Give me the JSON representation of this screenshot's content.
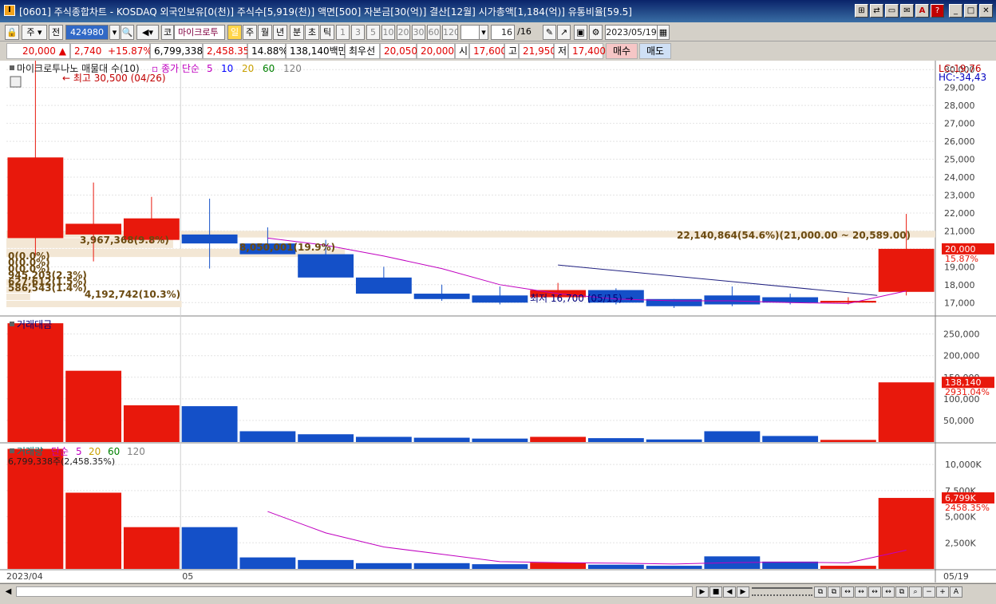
{
  "window": {
    "title": "[0601] 주식종합차트 - KOSDAQ 외국인보유[0(천)] 주식수[5,919(천)] 액면[500] 자본금[30(억)] 결산[12월] 시가총액[1,184(억)] 유통비율[59.5]",
    "app_icon": "I",
    "controls": [
      "⊞",
      "⇄",
      "▭",
      "✉",
      "A",
      "?",
      "_",
      "□",
      "✕"
    ]
  },
  "toolbar": {
    "mode": "주",
    "prefix": "전",
    "code": "424980",
    "stock_prefix": "코",
    "stock_name": "마이크로투",
    "periods": [
      "일",
      "주",
      "월",
      "년",
      "분",
      "초",
      "틱"
    ],
    "intervals": [
      "1",
      "3",
      "5",
      "10",
      "20",
      "30",
      "60",
      "120"
    ],
    "count": "16",
    "count_total": "/16",
    "date": "2023/05/19"
  },
  "quote": {
    "price": "20,000",
    "change": "2,740",
    "change_pct": "+15.87%",
    "volume": "6,799,338",
    "volume_pct": "2,458.35%",
    "turnover": "14.88%",
    "amount": "138,140백만",
    "best_label": "최우선",
    "best_ask": "20,050",
    "best_bid": "20,000",
    "open_label": "시",
    "open": "17,600",
    "high_label": "고",
    "high": "21,950",
    "low_label": "저",
    "low": "17,400",
    "buy_label": "매수",
    "sell_label": "매도"
  },
  "chart_data": {
    "type": "candlestick",
    "title": "마이크로투나노 매물대 수(10)",
    "indicator_title": "종가 단순",
    "ma_periods": [
      "5",
      "10",
      "20",
      "60",
      "120"
    ],
    "ma_colors": [
      "#c000c0",
      "#0000ff",
      "#c8a000",
      "#008000",
      "#808080"
    ],
    "candles": [
      {
        "o": 20600,
        "h": 30500,
        "l": 19600,
        "c": 25100
      },
      {
        "o": 20800,
        "h": 23700,
        "l": 19300,
        "c": 21400
      },
      {
        "o": 20500,
        "h": 22900,
        "l": 20300,
        "c": 21700
      },
      {
        "o": 20800,
        "h": 22800,
        "l": 18900,
        "c": 20300
      },
      {
        "o": 20300,
        "h": 21200,
        "l": 19800,
        "c": 19700
      },
      {
        "o": 19700,
        "h": 20500,
        "l": 18600,
        "c": 18400
      },
      {
        "o": 18400,
        "h": 19000,
        "l": 17600,
        "c": 17500
      },
      {
        "o": 17500,
        "h": 18000,
        "l": 17100,
        "c": 17200
      },
      {
        "o": 17400,
        "h": 17900,
        "l": 16900,
        "c": 17000
      },
      {
        "o": 17300,
        "h": 18100,
        "l": 17200,
        "c": 17700
      },
      {
        "o": 17700,
        "h": 17800,
        "l": 16900,
        "c": 17000
      },
      {
        "o": 17200,
        "h": 17200,
        "l": 16700,
        "c": 16800
      },
      {
        "o": 17400,
        "h": 17900,
        "l": 16800,
        "c": 16900
      },
      {
        "o": 17300,
        "h": 17500,
        "l": 16900,
        "c": 17000
      },
      {
        "o": 17000,
        "h": 17300,
        "l": 16900,
        "c": 17100
      },
      {
        "o": 17600,
        "h": 21950,
        "l": 17400,
        "c": 20000
      }
    ],
    "ma5": [
      null,
      null,
      null,
      null,
      20600,
      20200,
      19600,
      18900,
      18000,
      17500,
      17200,
      17100,
      17100,
      17000,
      16950,
      17650
    ],
    "trend_line": {
      "from_index": 9.5,
      "from_value": 19100,
      "to_index": 15,
      "to_value": 17400
    },
    "price_axis": {
      "min": 16300,
      "max": 30500,
      "ticks": [
        "17,000",
        "18,000",
        "19,000",
        "20,000",
        "21,000",
        "22,000",
        "23,000",
        "24,000",
        "25,000",
        "26,000",
        "27,000",
        "28,000",
        "29,000",
        "30,000"
      ]
    },
    "lc": "LC:19,76",
    "hc": "HC:-34,43",
    "current_price_label": "20,000",
    "current_pct_label": "15.87%",
    "high_label": "최고 30,500 (04/26)",
    "low_label": "최저 16,700 (05/15)",
    "volume_profile": [
      {
        "low": 16700,
        "high": 17100,
        "label": "4,192,742(10.3%)"
      },
      {
        "low": 17100,
        "high": 17500,
        "label": "586,543(1.4%)"
      },
      {
        "low": 17500,
        "high": 17900,
        "label": "627,612(1.5%)"
      },
      {
        "low": 17900,
        "high": 18300,
        "label": "945,203(2.3%)"
      },
      {
        "low": 18300,
        "high": 18700,
        "label": "0(0.0%)"
      },
      {
        "low": 18700,
        "high": 19100,
        "label": "0(0.0%)"
      },
      {
        "low": 19100,
        "high": 19500,
        "label": "0(0.0%)"
      },
      {
        "low": 19500,
        "high": 20000,
        "label": "8,050,001(19.9%)"
      },
      {
        "low": 20000,
        "high": 20600,
        "label": "3,967,368(9.8%)"
      },
      {
        "low": 20589,
        "high": 21000,
        "label": "22,140,864(54.6%)(21,000.00 ~ 20,589.00)"
      }
    ],
    "amount_title": "거래대금",
    "amount_values": [
      275000,
      165000,
      85000,
      83000,
      25000,
      18000,
      12000,
      10000,
      8000,
      12000,
      9000,
      6000,
      25000,
      14000,
      5000,
      138140
    ],
    "amount_axis": {
      "max": 290000,
      "ticks": [
        {
          "v": 50000,
          "t": "50,000"
        },
        {
          "v": 100000,
          "t": "100,000"
        },
        {
          "v": 150000,
          "t": "150,000"
        },
        {
          "v": 200000,
          "t": "200,000"
        },
        {
          "v": 250000,
          "t": "250,000"
        }
      ]
    },
    "amount_current": "138,140",
    "amount_pct": "2931.04%",
    "volume_title": "거래량",
    "volume_indicator": "단순",
    "volume_ma_periods": [
      "5",
      "20",
      "60",
      "120"
    ],
    "volume_ma_colors": [
      "#c000c0",
      "#c8a000",
      "#008000",
      "#808080"
    ],
    "volume_values": [
      11500,
      7300,
      4000,
      4000,
      1100,
      850,
      550,
      550,
      450,
      600,
      400,
      300,
      1200,
      700,
      300,
      6799
    ],
    "volume_ma5": [
      null,
      null,
      null,
      null,
      5500,
      3450,
      2100,
      1400,
      700,
      600,
      550,
      470,
      600,
      650,
      580,
      1800
    ],
    "volume_axis": {
      "max": 12000,
      "ticks": [
        {
          "v": 2500,
          "t": "2,500K"
        },
        {
          "v": 5000,
          "t": "5,000K"
        },
        {
          "v": 7500,
          "t": "7,500K"
        },
        {
          "v": 10000,
          "t": "10,000K"
        }
      ]
    },
    "volume_current": "6,799K",
    "volume_pct": "2458.35%",
    "volume_info": "6,799,338주(2,458.35%)",
    "x_labels": {
      "start": "2023/04",
      "may": "05",
      "end": "05/19"
    },
    "colors": {
      "up": "#e8180c",
      "down": "#1450c8",
      "ma5": "#c000c0",
      "trend": "#202080"
    }
  }
}
